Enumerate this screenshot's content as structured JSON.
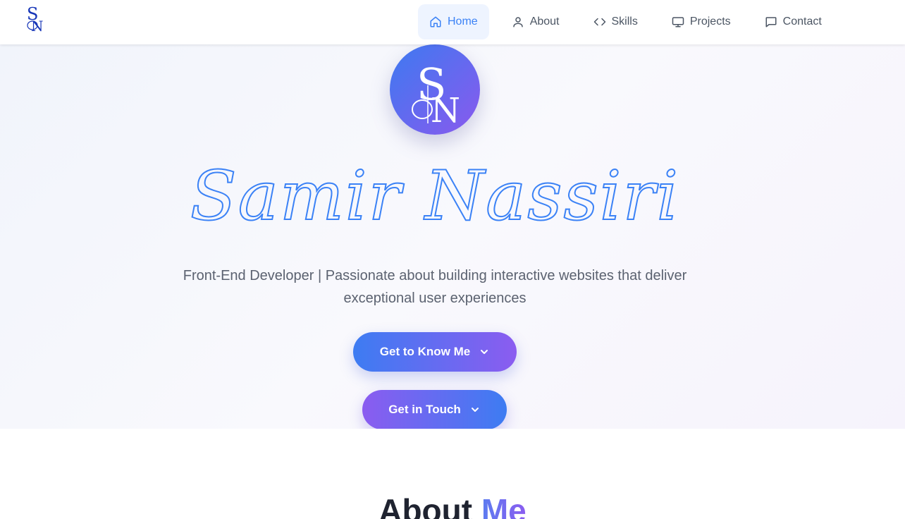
{
  "nav": {
    "logo_text": "SN",
    "items": [
      {
        "label": "Home",
        "icon": "home-icon",
        "active": true
      },
      {
        "label": "About",
        "icon": "user-icon",
        "active": false
      },
      {
        "label": "Skills",
        "icon": "code-icon",
        "active": false
      },
      {
        "label": "Projects",
        "icon": "monitor-icon",
        "active": false
      },
      {
        "label": "Contact",
        "icon": "message-icon",
        "active": false
      }
    ]
  },
  "hero": {
    "avatar_text": "SN",
    "name": "Samir Nassiri",
    "tagline": "Front-End Developer | Passionate about building interactive websites that deliver exceptional user experiences",
    "buttons": {
      "know_me": "Get to Know Me",
      "get_in_touch": "Get in Touch"
    }
  },
  "about": {
    "heading_main": "About",
    "heading_accent": "Me"
  },
  "colors": {
    "accent": "#3b82f6",
    "accent_purple": "#8b5cf6",
    "nav_active_bg": "#eef4ff",
    "text_muted": "#5b6270"
  }
}
